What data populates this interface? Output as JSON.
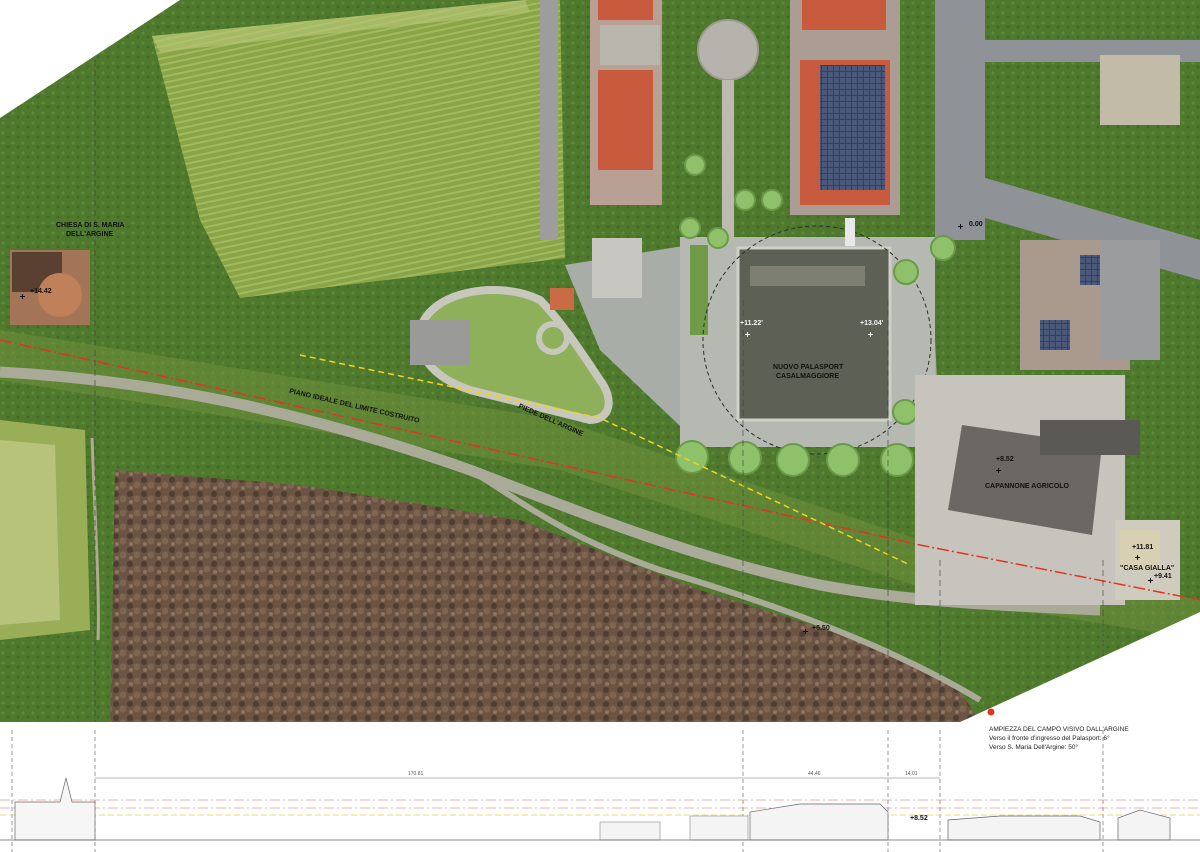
{
  "map": {
    "labels": {
      "chiesa": [
        "CHIESA DI S. MARIA",
        "DELL'ARGINE"
      ],
      "palasport": [
        "NUOVO PALASPORT",
        "CASALMAGGIORE"
      ],
      "capannone": "CAPANNONE AGRICOLO",
      "casa_gialla": "\"CASA GIALLA\"",
      "piano_ideale": "PIANO IDEALE DEL LIMITE COSTRUITO",
      "piede_argine": "PIEDE DELL'ARGINE"
    },
    "elevations": {
      "chiesa": "+14.42",
      "palasport_w": "+11.22'",
      "palasport_e": "+13.04'",
      "street": "0.00",
      "capannone": "+8.52",
      "casa_gialla_top": "+11.81",
      "casa_gialla_bottom": "+9.41",
      "road": "+6.50"
    },
    "colors": {
      "red_limit_line": "#e53222",
      "yellow_foot_line": "#f2d21a",
      "field": "#7e9a3a",
      "woods": "#5e4a38",
      "roof_red": "#c85a3e"
    }
  },
  "caption": {
    "title": "AMPIEZZA DEL CAMPO VISIVO DALL'ARGINE",
    "line1": "Verso il fronte d'ingresso del Palasport: 6°",
    "line2": "Verso S. Maria Dell'Argine: 50°"
  },
  "section": {
    "dim1": "170.81",
    "dim2": "44.46",
    "dim3": "14.01",
    "elev": "+8.52"
  }
}
